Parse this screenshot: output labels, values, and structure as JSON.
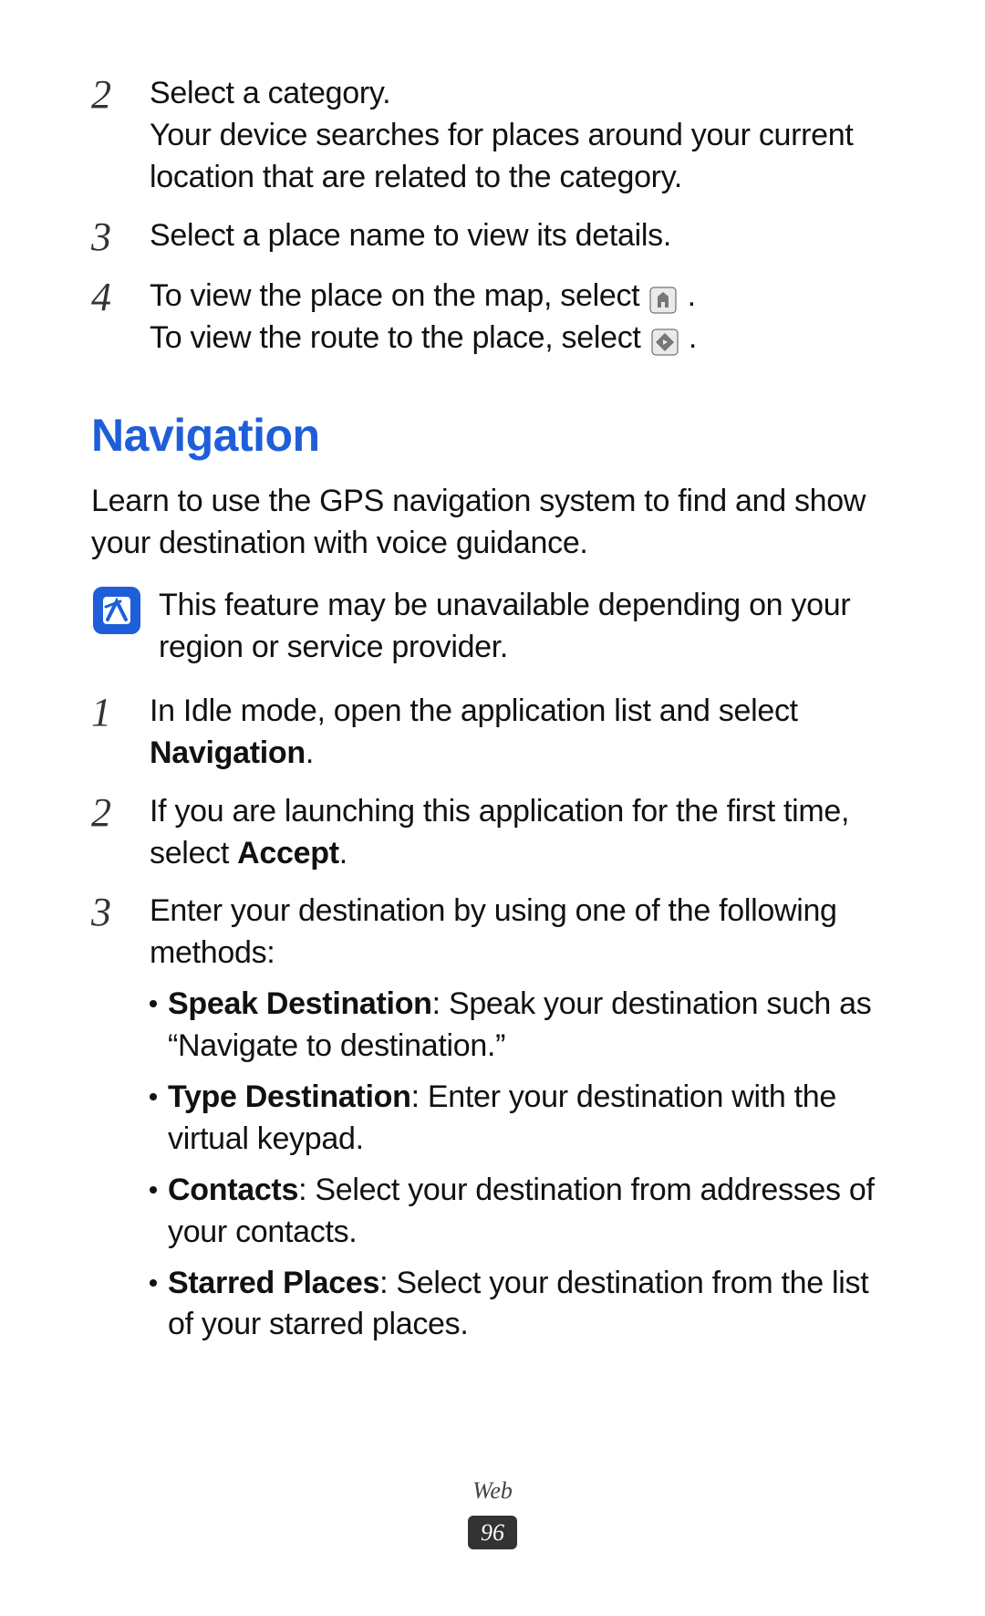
{
  "top_steps": [
    {
      "num": "2",
      "text": "Select a category.",
      "text2": "Your device searches for places around your current location that are related to the category."
    },
    {
      "num": "3",
      "text": "Select a place name to view its details."
    },
    {
      "num": "4",
      "line_a_pre": "To view the place on the map, select ",
      "line_a_post": ".",
      "line_b_pre": "To view the route to the place, select ",
      "line_b_post": "."
    }
  ],
  "heading": "Navigation",
  "intro": "Learn to use the GPS navigation system to find and show your destination with voice guidance.",
  "note": "This feature may be unavailable depending on your region or service provider.",
  "nav_steps": [
    {
      "num": "1",
      "pre": "In Idle mode, open the application list and select ",
      "bold": "Navigation",
      "post": "."
    },
    {
      "num": "2",
      "pre": "If you are launching this application for the first time, select ",
      "bold": "Accept",
      "post": "."
    },
    {
      "num": "3",
      "text": "Enter your destination by using one of the following methods:",
      "bullets": [
        {
          "bold": "Speak Destination",
          "rest": ": Speak your destination such as “Navigate to destination.”"
        },
        {
          "bold": "Type Destination",
          "rest": ": Enter your destination with the virtual keypad."
        },
        {
          "bold": "Contacts",
          "rest": ": Select your destination from addresses of your contacts."
        },
        {
          "bold": "Starred Places",
          "rest": ": Select your destination from the list of your starred places."
        }
      ]
    }
  ],
  "footer": {
    "category": "Web",
    "page": "96"
  }
}
